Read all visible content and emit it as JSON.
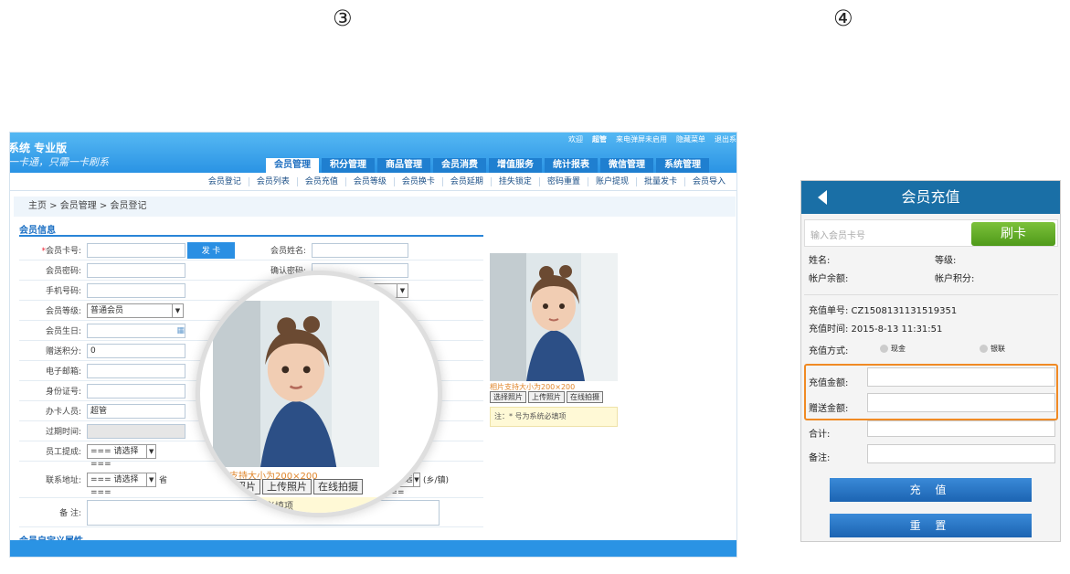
{
  "markers": {
    "left": "③",
    "right": "④"
  },
  "desktop": {
    "brand": "系统 专业版",
    "slogan": "一卡通，只需一卡刷系",
    "top_links": [
      "欢迎",
      "超管",
      "来电弹屏未启用",
      "隐藏菜单",
      "退出系"
    ],
    "tabs": [
      "会员管理",
      "积分管理",
      "商品管理",
      "会员消费",
      "增值服务",
      "统计报表",
      "微信管理",
      "系统管理"
    ],
    "subnav": [
      "会员登记",
      "会员列表",
      "会员充值",
      "会员等级",
      "会员换卡",
      "会员延期",
      "挂失锁定",
      "密码重置",
      "账户提现",
      "批量发卡",
      "会员导入"
    ],
    "breadcrumb": "主页 > 会员管理 > 会员登记",
    "section_title": "会员信息",
    "form": {
      "card_no": "会员卡号:",
      "issue_btn": "发 卡",
      "name": "会员姓名:",
      "password": "会员密码:",
      "confirm_password": "确认密码:",
      "phone": "手机号码:",
      "level": "会员等级:",
      "level_value": "普通会员",
      "birthday": "会员生日:",
      "gift_points": "赠送积分:",
      "gift_points_value": "0",
      "email": "电子邮箱:",
      "id_no": "身份证号:",
      "operator": "办卡人员:",
      "operator_value": "超管",
      "expire": "过期时间:",
      "staff_commission": "员工提成:",
      "select_placeholder": "=== 请选择 ===",
      "address": "联系地址:",
      "addr_province": "省",
      "addr_town": "(乡/镇)",
      "remark": "备 注:"
    },
    "custom_attrs": "会员自定义属性",
    "photo": {
      "caption": "相片支持大小为200×200",
      "buttons": [
        "选择照片",
        "上传照片",
        "在线拍摄"
      ],
      "note": "注：* 号为系统必填项"
    },
    "magnifier": {
      "caption": "相片支持大小为200×200",
      "buttons": [
        "选择照片",
        "上传照片",
        "在线拍摄"
      ],
      "note": "为系统必填项"
    }
  },
  "mobile": {
    "title": "会员充值",
    "search_placeholder": "输入会员卡号",
    "swipe_btn": "刷卡",
    "name_label": "姓名:",
    "level_label": "等级:",
    "balance_label": "帐户余额:",
    "points_label": "帐户积分:",
    "order_no": "充值单号: CZ1508131131519351",
    "time": "充值时间: 2015-8-13 11:31:51",
    "method_label": "充值方式:",
    "method_cash": "现金",
    "method_union": "银联",
    "amount_label": "充值金额:",
    "gift_label": "赠送金额:",
    "total_label": "合计:",
    "remark_label": "备注:",
    "submit_btn": "充 值",
    "reset_btn": "重 置"
  }
}
